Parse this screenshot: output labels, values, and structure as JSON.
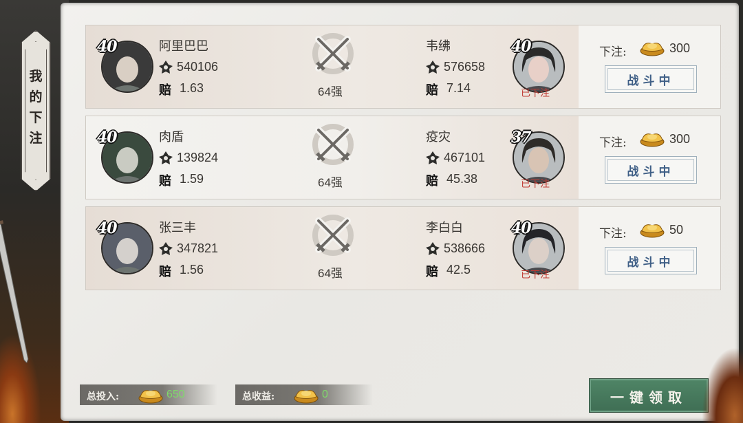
{
  "side_tab": {
    "label": "我的下注"
  },
  "bets": [
    {
      "left": {
        "level": "40",
        "name": "阿里巴巴",
        "power": "540106",
        "odds": "1.63",
        "avatar_icon": "warrior-red-headband-portrait"
      },
      "round": "64强",
      "right": {
        "level": "40",
        "name": "韦绋",
        "power": "576658",
        "odds": "7.14",
        "placed": "已下注",
        "avatar_icon": "maiden-pink-portrait"
      },
      "bet": {
        "label": "下注:",
        "amount": "300",
        "status": "战斗中"
      }
    },
    {
      "left": {
        "level": "40",
        "name": "肉盾",
        "power": "139824",
        "odds": "1.59",
        "avatar_icon": "masked-green-portrait"
      },
      "round": "64强",
      "right": {
        "level": "37",
        "name": "疫灾",
        "power": "467101",
        "odds": "45.38",
        "placed": "已下注",
        "avatar_icon": "headband-swordsman-portrait"
      },
      "bet": {
        "label": "下注:",
        "amount": "300",
        "status": "战斗中"
      }
    },
    {
      "left": {
        "level": "40",
        "name": "张三丰",
        "power": "347821",
        "odds": "1.56",
        "avatar_icon": "white-hair-master-portrait"
      },
      "round": "64强",
      "right": {
        "level": "40",
        "name": "李白白",
        "power": "538666",
        "odds": "42.5",
        "placed": "已下注",
        "avatar_icon": "dark-hair-lady-portrait"
      },
      "bet": {
        "label": "下注:",
        "amount": "50",
        "status": "战斗中"
      }
    }
  ],
  "odds_glyph": "赔",
  "totals": {
    "invest_label": "总投入:",
    "invest_value": "650",
    "income_label": "总收益:",
    "income_value": "0"
  },
  "claim_button": "一键领取",
  "colors": {
    "band": "#ebe3dc",
    "accent_green": "#3f6e54",
    "placed_red": "#c03c35",
    "button_blue": "#3f5f86"
  }
}
